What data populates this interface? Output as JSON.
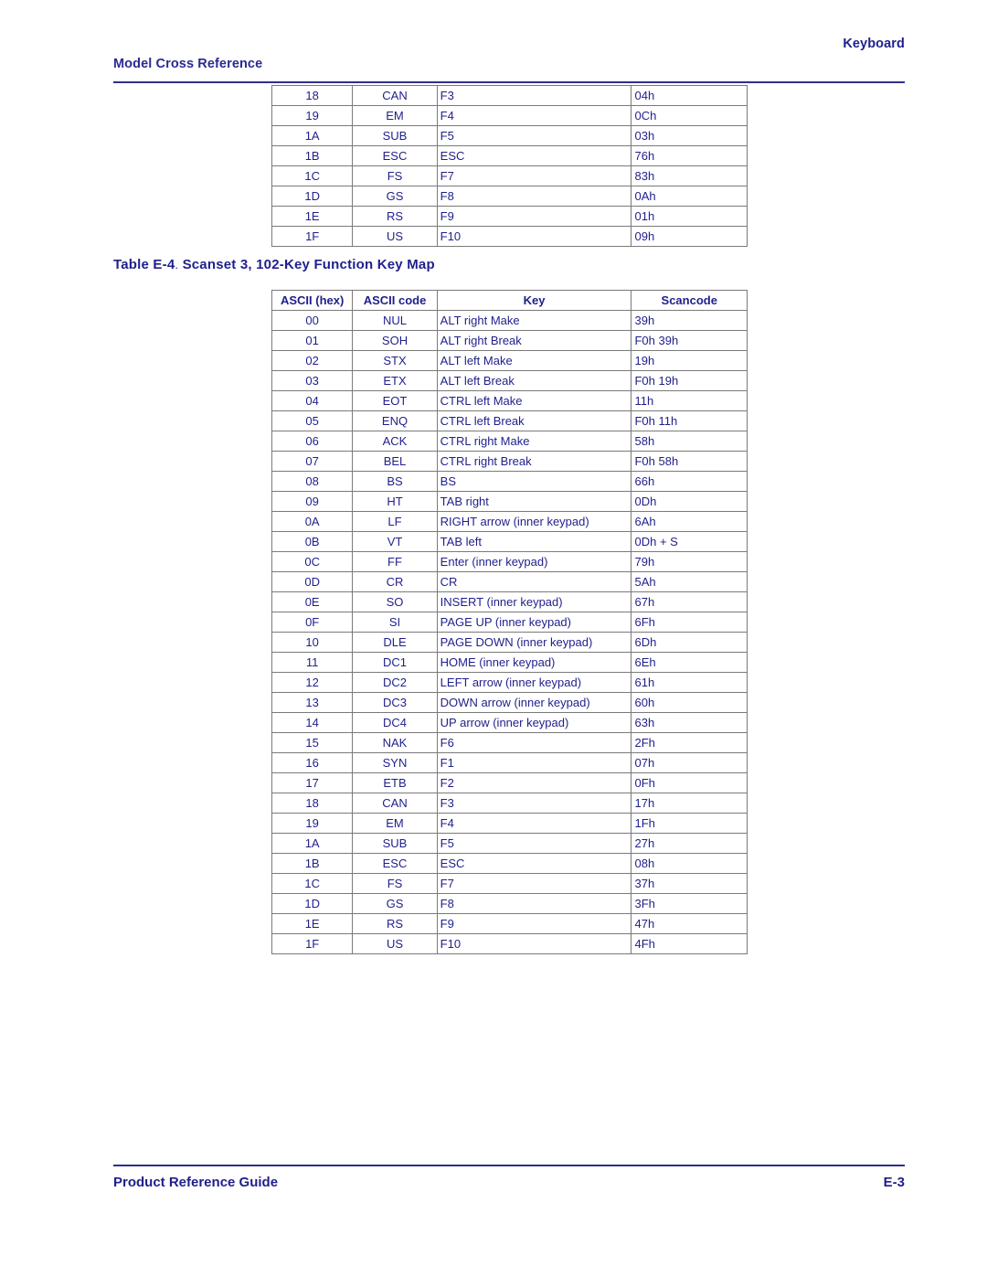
{
  "header": {
    "running_head": "Keyboard",
    "section_title": "Model Cross Reference"
  },
  "top_table": {
    "columns": [
      "ASCII (hex)",
      "ASCII code",
      "Key",
      "Scancode"
    ],
    "rows": [
      [
        "18",
        "CAN",
        "F3",
        "04h"
      ],
      [
        "19",
        "EM",
        "F4",
        "0Ch"
      ],
      [
        "1A",
        "SUB",
        "F5",
        "03h"
      ],
      [
        "1B",
        "ESC",
        "ESC",
        "76h"
      ],
      [
        "1C",
        "FS",
        "F7",
        "83h"
      ],
      [
        "1D",
        "GS",
        "F8",
        "0Ah"
      ],
      [
        "1E",
        "RS",
        "F9",
        "01h"
      ],
      [
        "1F",
        "US",
        "F10",
        "09h"
      ]
    ]
  },
  "table_caption": {
    "number": "Table E-4",
    "separator": ".",
    "title": "Scanset 3, 102-Key Function Key Map"
  },
  "main_table": {
    "columns": [
      "ASCII (hex)",
      "ASCII code",
      "Key",
      "Scancode"
    ],
    "rows": [
      [
        "00",
        "NUL",
        "ALT right Make",
        "39h"
      ],
      [
        "01",
        "SOH",
        "ALT right Break",
        "F0h 39h"
      ],
      [
        "02",
        "STX",
        "ALT left Make",
        "19h"
      ],
      [
        "03",
        "ETX",
        "ALT left Break",
        "F0h 19h"
      ],
      [
        "04",
        "EOT",
        "CTRL left Make",
        "11h"
      ],
      [
        "05",
        "ENQ",
        "CTRL left Break",
        "F0h 11h"
      ],
      [
        "06",
        "ACK",
        "CTRL right Make",
        "58h"
      ],
      [
        "07",
        "BEL",
        "CTRL right Break",
        "F0h 58h"
      ],
      [
        "08",
        "BS",
        "BS",
        "66h"
      ],
      [
        "09",
        "HT",
        "TAB right",
        "0Dh"
      ],
      [
        "0A",
        "LF",
        "RIGHT arrow (inner keypad)",
        "6Ah"
      ],
      [
        "0B",
        "VT",
        "TAB left",
        "0Dh + S"
      ],
      [
        "0C",
        "FF",
        "Enter (inner keypad)",
        "79h"
      ],
      [
        "0D",
        "CR",
        "CR",
        "5Ah"
      ],
      [
        "0E",
        "SO",
        "INSERT (inner keypad)",
        "67h"
      ],
      [
        "0F",
        "SI",
        "PAGE UP (inner keypad)",
        "6Fh"
      ],
      [
        "10",
        "DLE",
        "PAGE DOWN (inner keypad)",
        "6Dh"
      ],
      [
        "11",
        "DC1",
        "HOME (inner keypad)",
        "6Eh"
      ],
      [
        "12",
        "DC2",
        "LEFT arrow (inner keypad)",
        "61h"
      ],
      [
        "13",
        "DC3",
        "DOWN arrow (inner keypad)",
        "60h"
      ],
      [
        "14",
        "DC4",
        "UP arrow (inner keypad)",
        "63h"
      ],
      [
        "15",
        "NAK",
        "F6",
        "2Fh"
      ],
      [
        "16",
        "SYN",
        "F1",
        "07h"
      ],
      [
        "17",
        "ETB",
        "F2",
        "0Fh"
      ],
      [
        "18",
        "CAN",
        "F3",
        "17h"
      ],
      [
        "19",
        "EM",
        "F4",
        "1Fh"
      ],
      [
        "1A",
        "SUB",
        "F5",
        "27h"
      ],
      [
        "1B",
        "ESC",
        "ESC",
        "08h"
      ],
      [
        "1C",
        "FS",
        "F7",
        "37h"
      ],
      [
        "1D",
        "GS",
        "F8",
        "3Fh"
      ],
      [
        "1E",
        "RS",
        "F9",
        "47h"
      ],
      [
        "1F",
        "US",
        "F10",
        "4Fh"
      ]
    ]
  },
  "footer": {
    "guide_title": "Product Reference Guide",
    "page_number": "E-3"
  },
  "colors": {
    "text_navy": "#1f1f8c",
    "rule_navy": "#2f2f8f",
    "table_border": "#7a7a7a",
    "page_background": "#ffffff"
  }
}
